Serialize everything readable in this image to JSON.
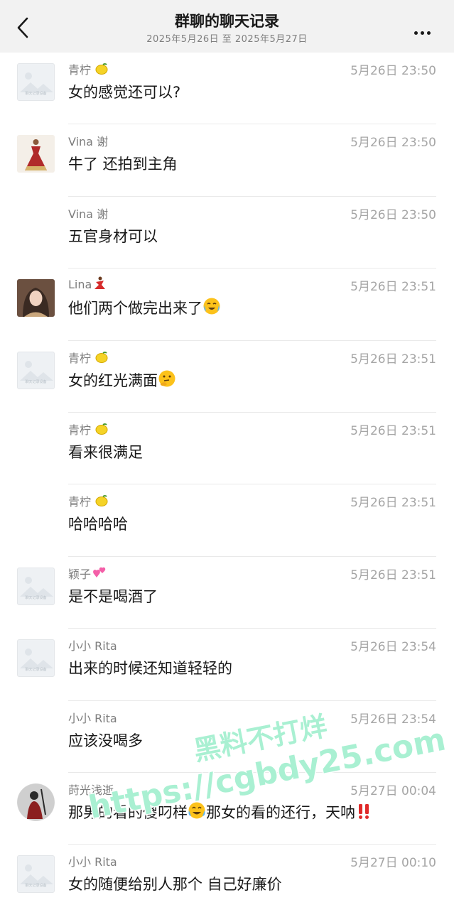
{
  "header": {
    "title": "群聊的聊天记录",
    "subtitle": "2025年5月26日 至 2025年5月27日"
  },
  "placeholder_avatar_text": "聊天记录设备",
  "messages": [
    {
      "sender": "青柠",
      "name_emoji": "lemon-icon",
      "time": "5月26日 23:50",
      "text": "女的感觉还可以?",
      "avatar": "placeholder"
    },
    {
      "sender": "Vina 谢",
      "time": "5月26日 23:50",
      "text": "牛了 还拍到主角",
      "avatar": "dress"
    },
    {
      "sender": "Vina 谢",
      "time": "5月26日 23:50",
      "text": "五官身材可以",
      "avatar": "none"
    },
    {
      "sender": "Lina",
      "name_emoji": "dancer-icon",
      "time": "5月26日 23:51",
      "text": "他们两个做完出来了",
      "text_emoji": "crying-laughing-icon",
      "avatar": "woman"
    },
    {
      "sender": "青柠",
      "name_emoji": "lemon-icon",
      "time": "5月26日 23:51",
      "text": "女的红光满面",
      "text_emoji": "thinking-face-icon",
      "avatar": "placeholder"
    },
    {
      "sender": "青柠",
      "name_emoji": "lemon-icon",
      "time": "5月26日 23:51",
      "text": "看来很满足",
      "avatar": "none"
    },
    {
      "sender": "青柠",
      "name_emoji": "lemon-icon",
      "time": "5月26日 23:51",
      "text": "哈哈哈哈",
      "avatar": "none"
    },
    {
      "sender": "颖子",
      "name_emoji": "hearts-icon",
      "time": "5月26日 23:51",
      "text": "是不是喝酒了",
      "avatar": "placeholder"
    },
    {
      "sender": "小小 Rita",
      "time": "5月26日 23:54",
      "text": "出来的时候还知道轻轻的",
      "avatar": "placeholder"
    },
    {
      "sender": "小小 Rita",
      "time": "5月26日 23:54",
      "text": "应该没喝多",
      "avatar": "none"
    },
    {
      "sender": "莳光浅逝",
      "time": "5月27日 00:04",
      "text_parts": [
        "那男的看的傻叼样",
        "那女的看的还行，天呐"
      ],
      "text_emoji": "joy-icon",
      "text_end_emoji": "double-exclamation-icon",
      "avatar": "figure"
    },
    {
      "sender": "小小 Rita",
      "time": "5月27日 00:10",
      "text": "女的随便给别人那个 自己好廉价",
      "avatar": "placeholder"
    }
  ],
  "watermark": {
    "line1": "黑料不打烊",
    "line2": "https://cgbdy25.com",
    "color": "#a9f0d2"
  }
}
